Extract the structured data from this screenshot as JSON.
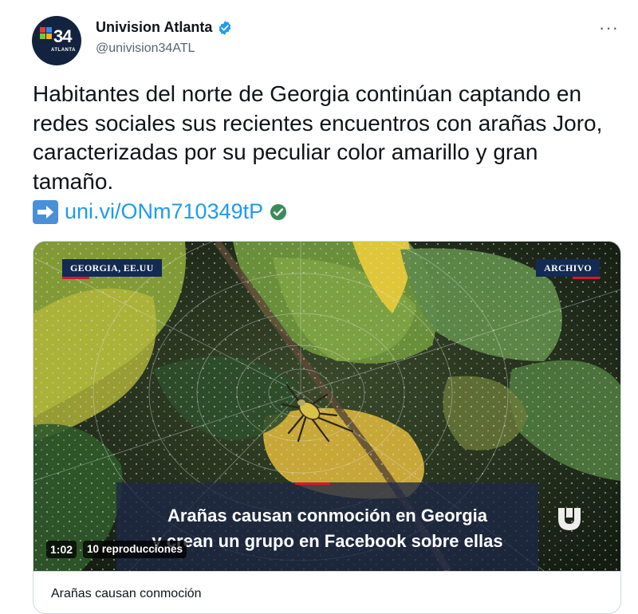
{
  "account": {
    "display_name": "Univision Atlanta",
    "handle": "@univision34ATL",
    "verified": true,
    "avatar": {
      "logo_number": "34",
      "logo_sub": "ATLANTA"
    }
  },
  "more_label": "···",
  "tweet": {
    "text": "Habitantes del norte de Georgia continúan captando en redes sociales sus recientes encuentros con arañas Joro, caracterizadas por su peculiar color amarillo y gran tamaño.",
    "link_arrow": "➡",
    "link_text": "uni.vi/ONm710349tP"
  },
  "media": {
    "tag_left": "GEORGIA, EE.UU",
    "tag_right": "ARCHIVO",
    "headline_line1": "Arañas causan conmoción en Georgia",
    "headline_line2": "y crean un grupo en Facebook sobre ellas",
    "duration": "1:02",
    "views": "10 reproducciones",
    "card_title": "Arañas causan conmoción"
  },
  "colors": {
    "link": "#1d9bf0",
    "verified": "#1d9bf0",
    "handle": "#536471",
    "brand_navy": "#132a52",
    "brand_red": "#d21a2c"
  },
  "icons": {
    "verified": "verified-badge-icon",
    "more": "more-icon",
    "arrow": "right-arrow-icon",
    "link_check": "check-circle-icon",
    "brand": "univision-logo-icon"
  }
}
